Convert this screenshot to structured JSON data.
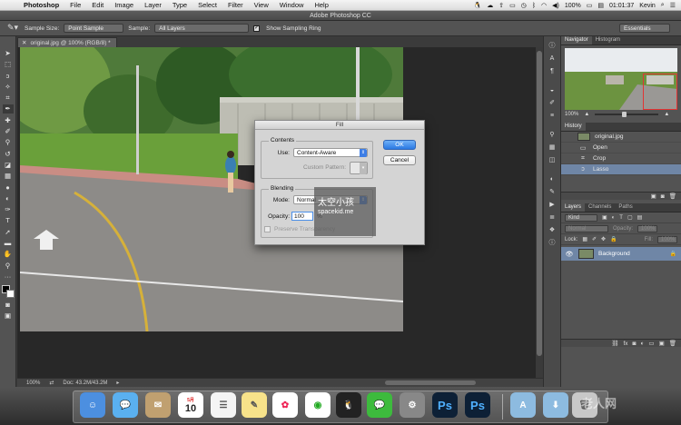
{
  "menubar": {
    "app_name": "Photoshop",
    "items": [
      "File",
      "Edit",
      "Image",
      "Layer",
      "Type",
      "Select",
      "Filter",
      "View",
      "Window",
      "Help"
    ],
    "battery": "100%",
    "time": "01:01:37",
    "user": "Kevin"
  },
  "window": {
    "title": "Adobe Photoshop CC"
  },
  "options": {
    "sample_size_label": "Sample Size:",
    "sample_size_value": "Point Sample",
    "sample_label": "Sample:",
    "sample_value": "All Layers",
    "sampling_ring_label": "Show Sampling Ring",
    "workspace": "Essentials"
  },
  "document": {
    "tab_title": "original.jpg @ 100% (RGB/8) *",
    "zoom": "100%",
    "doc_info": "Doc: 43.2M/43.2M"
  },
  "panels": {
    "navigator_tab": "Navigator",
    "histogram_tab": "Histogram",
    "navigator_zoom": "100%",
    "history_tab": "History",
    "history_snapshot": "original.jpg",
    "history_items": [
      "Open",
      "Crop",
      "Lasso"
    ],
    "layers_tabs": [
      "Layers",
      "Channels",
      "Paths"
    ],
    "kind_label": "Kind",
    "blend_mode": "Normal",
    "opacity_label": "Opacity:",
    "opacity_value": "100%",
    "lock_label": "Lock:",
    "fill_label": "Fill:",
    "fill_value": "100%",
    "layer_name": "Background"
  },
  "fill_dialog": {
    "title": "Fill",
    "contents_label": "Contents",
    "use_label": "Use:",
    "use_value": "Content-Aware",
    "custom_pattern_label": "Custom Pattern:",
    "blending_label": "Blending",
    "mode_label": "Mode:",
    "mode_value": "Normal",
    "opacity_label": "Opacity:",
    "opacity_value": "100",
    "percent": "%",
    "preserve_label": "Preserve Transparency",
    "ok": "OK",
    "cancel": "Cancel"
  },
  "watermark": {
    "zh": "太空小孩",
    "en": "spacekid.me"
  },
  "dock": {
    "calendar_month": "5月",
    "calendar_day": "10",
    "ps1": "Ps",
    "ps2": "Ps",
    "site_watermark": "老人网"
  }
}
